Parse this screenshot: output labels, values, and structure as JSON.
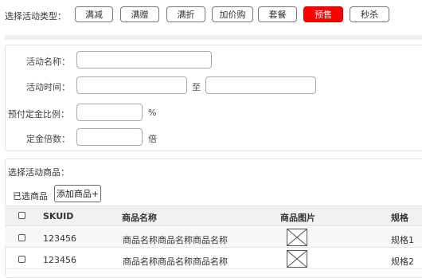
{
  "activity_type": {
    "label": "选择活动类型：",
    "buttons": [
      "满减",
      "满赠",
      "满折",
      "加价购",
      "套餐",
      "预售",
      "秒杀"
    ],
    "active_color": "#ff0000"
  },
  "form": {
    "name_label": "活动名称：",
    "time_label": "活动时间：",
    "time_separator": "至",
    "deposit_ratio_label": "预付定金比例：",
    "deposit_ratio_unit": "%",
    "multiplier_label": "定金倍数：",
    "multiplier_unit": "倍"
  },
  "goods": {
    "section_title": "选择活动商品：",
    "selected_label": "已选商品",
    "add_button": "添加商品+",
    "columns": [
      "SKUID",
      "商品名称",
      "商品图片",
      "规格"
    ],
    "rows": [
      {
        "skuid": "123456",
        "name": "商品名称商品名称商品名称",
        "image_icon": "image-placeholder-icon",
        "spec": "规格1"
      },
      {
        "skuid": "123456",
        "name": "商品名称商品名称商品名称",
        "image_icon": "image-placeholder-icon",
        "spec": "规格2"
      }
    ]
  }
}
